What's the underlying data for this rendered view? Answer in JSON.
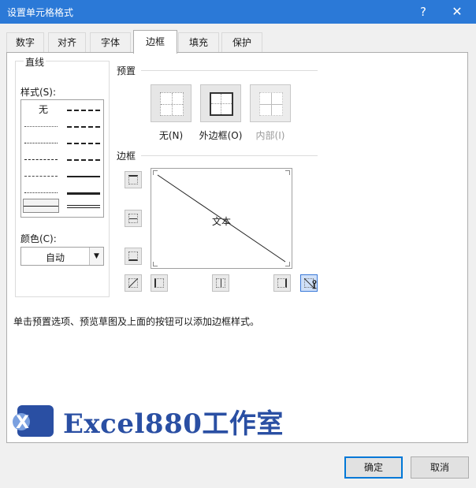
{
  "window": {
    "title": "设置单元格格式",
    "help_glyph": "?",
    "close_glyph": "✕"
  },
  "tabs": [
    {
      "label": "数字"
    },
    {
      "label": "对齐"
    },
    {
      "label": "字体"
    },
    {
      "label": "边框",
      "active": true
    },
    {
      "label": "填充"
    },
    {
      "label": "保护"
    }
  ],
  "line_group": {
    "title": "直线",
    "style_label": "样式(S):",
    "none_label": "无",
    "color_label": "颜色(C):",
    "color_value": "自动"
  },
  "presets": {
    "title": "预置",
    "items": [
      {
        "label": "无(N)",
        "enabled": true
      },
      {
        "label": "外边框(O)",
        "enabled": true
      },
      {
        "label": "内部(I)",
        "enabled": false
      }
    ]
  },
  "border": {
    "title": "边框",
    "preview_text": "文本"
  },
  "hint": "单击预置选项、预览草图及上面的按钮可以添加边框样式。",
  "watermark": {
    "badge": "X",
    "text": "Excel880工作室"
  },
  "footer": {
    "ok": "确定",
    "cancel": "取消"
  },
  "colors": {
    "titlebar": "#2b79d7",
    "accent": "#0078d7",
    "watermark": "#2a4fa3"
  }
}
